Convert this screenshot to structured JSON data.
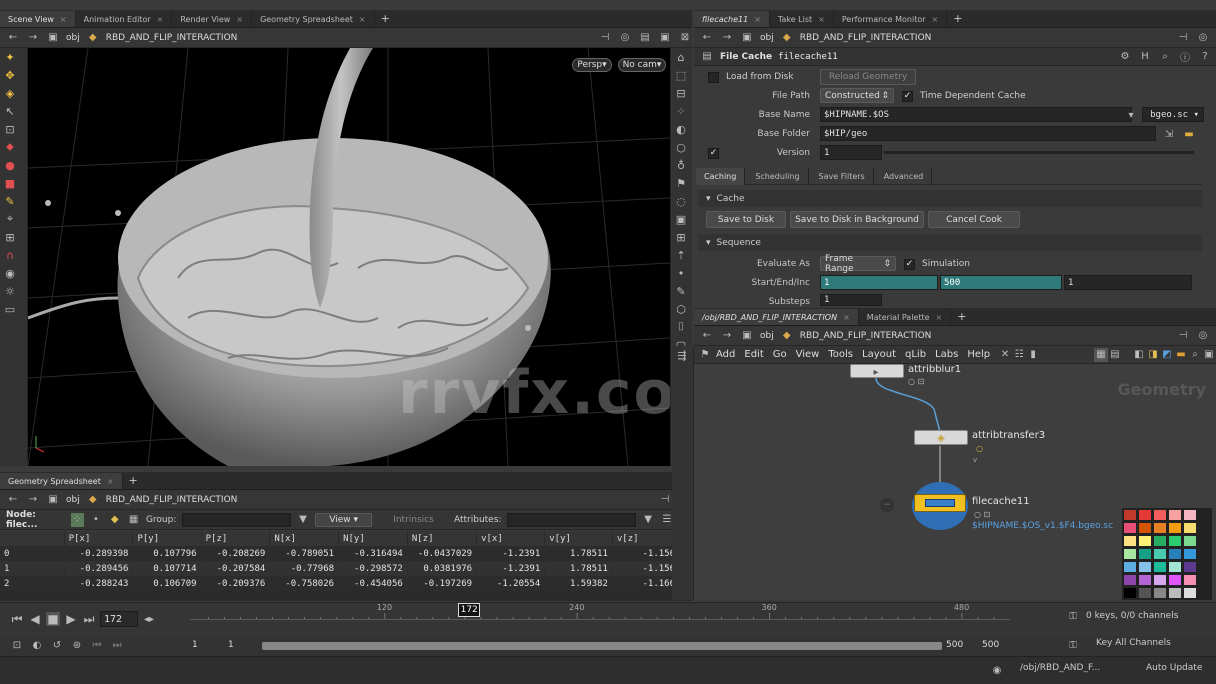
{
  "left_tabs": [
    {
      "label": "Scene View",
      "active": true
    },
    {
      "label": "Animation Editor",
      "active": false
    },
    {
      "label": "Render View",
      "active": false
    },
    {
      "label": "Geometry Spreadsheet",
      "active": false
    }
  ],
  "scene_path": {
    "context": "obj",
    "node": "RBD_AND_FLIP_INTERACTION"
  },
  "viewport": {
    "persp": "Persp▾",
    "cam": "No cam▾",
    "watermark": "rrvfx.com"
  },
  "right_tabs": [
    {
      "label": "filecache11",
      "active": true
    },
    {
      "label": "Take List",
      "active": false
    },
    {
      "label": "Performance Monitor",
      "active": false
    }
  ],
  "param_path": {
    "context": "obj",
    "node": "RBD_AND_FLIP_INTERACTION"
  },
  "params": {
    "node_type": "File Cache",
    "node_name": "filecache11",
    "load_from_disk": "Load from Disk",
    "reload_geometry": "Reload Geometry",
    "file_path_label": "File Path",
    "file_path_value": "Constructed",
    "time_dependent": "Time Dependent Cache",
    "base_name_label": "Base Name",
    "base_name_value": "$HIPNAME.$OS",
    "base_ext": "bgeo.sc",
    "base_folder_label": "Base Folder",
    "base_folder_value": "$HIP/geo",
    "version_label": "Version",
    "version_value": "1",
    "tabs": [
      "Caching",
      "Scheduling",
      "Save Filters",
      "Advanced"
    ],
    "cache_section": "Cache",
    "save_to_disk": "Save to Disk",
    "save_bg": "Save to Disk in Background",
    "cancel_cook": "Cancel Cook",
    "sequence_section": "Sequence",
    "evaluate_as_label": "Evaluate As",
    "evaluate_as_value": "Frame Range",
    "simulation": "Simulation",
    "start_end_label": "Start/End/Inc",
    "start": "1",
    "end": "500",
    "inc": "1",
    "substeps_label": "Substeps",
    "substeps_value": "1"
  },
  "network_tabs": [
    {
      "label": "/obj/RBD_AND_FLIP_INTERACTION",
      "active": true
    },
    {
      "label": "Material Palette",
      "active": false
    }
  ],
  "network_path": {
    "context": "obj",
    "node": "RBD_AND_FLIP_INTERACTION"
  },
  "network_menu": [
    "Add",
    "Edit",
    "Go",
    "View",
    "Tools",
    "Layout",
    "qLib",
    "Labs",
    "Help"
  ],
  "network": {
    "context_label": "Geometry",
    "node1": "attribblur1",
    "node2": "attribtransfer3",
    "node3": "filecache11",
    "node3_sub": "$HIPNAME.$OS_v1.$F4.bgeo.sc"
  },
  "spreadsheet": {
    "tab": "Geometry Spreadsheet",
    "node_label": "Node: filec...",
    "group_label": "Group:",
    "view": "View",
    "intrinsics": "Intrinsics",
    "attributes": "Attributes:",
    "columns": [
      "",
      "P[x]",
      "P[y]",
      "P[z]",
      "N[x]",
      "N[y]",
      "N[z]",
      "v[x]",
      "v[y]",
      "v[z]"
    ],
    "rows": [
      [
        "0",
        "-0.289398",
        "0.107796",
        "-0.208269",
        "-0.789051",
        "-0.316494",
        "-0.0437029",
        "-1.2391",
        "1.78511",
        "-1.156"
      ],
      [
        "1",
        "-0.289456",
        "0.107714",
        "-0.207584",
        "-0.77968",
        "-0.298572",
        "0.0381976",
        "-1.2391",
        "1.78511",
        "-1.156"
      ],
      [
        "2",
        "-0.288243",
        "0.106709",
        "-0.209376",
        "-0.758026",
        "-0.454056",
        "-0.197269",
        "-1.20554",
        "1.59382",
        "-1.166"
      ]
    ]
  },
  "timeline": {
    "current_frame": "172",
    "ticks": [
      "120",
      "240",
      "360",
      "480"
    ],
    "start": "1",
    "start2": "1",
    "end": "500",
    "end2": "500",
    "keys_channels": "0 keys, 0/0 channels",
    "key_all": "Key All Channels",
    "frame_fraction": 0.344
  },
  "status": {
    "path": "/obj/RBD_AND_F...",
    "update": "Auto Update"
  },
  "palette": [
    "#c0392b",
    "#e53935",
    "#f25f5c",
    "#f7a1a1",
    "#f4b6c2",
    "#e94e77",
    "#d35400",
    "#e67e22",
    "#f39c12",
    "#f7dc6f",
    "#ffe082",
    "#fff176",
    "#27ae60",
    "#2ecc71",
    "#7bd88f",
    "#a8e6a1",
    "#16a085",
    "#48c9b0",
    "#2980b9",
    "#3498db",
    "#5dade2",
    "#85c1e9",
    "#1abc9c",
    "#a3e4d7",
    "#5b3a8f",
    "#8e44ad",
    "#b266d3",
    "#d7a8f0",
    "#e056fd",
    "#f78fb3",
    "#000000",
    "#555555",
    "#888888",
    "#bbbbbb",
    "#dddddd",
    "#ffffff"
  ]
}
